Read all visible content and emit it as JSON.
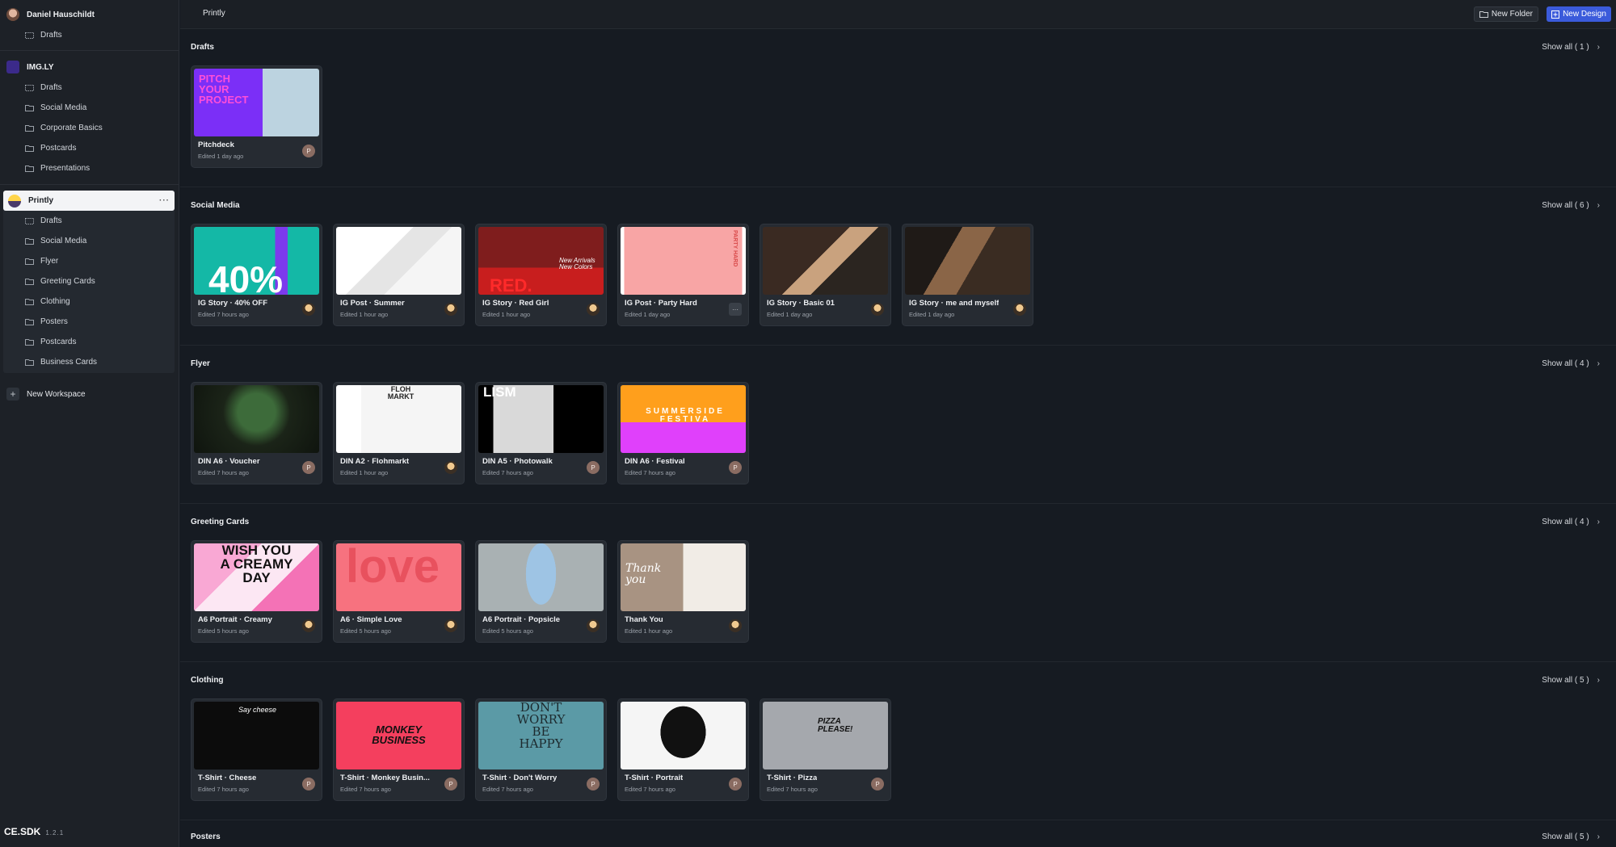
{
  "sidebar": {
    "user": {
      "name": "Daniel Hauschildt",
      "folders": [
        "Drafts"
      ]
    },
    "imgly": {
      "name": "IMG.LY",
      "folders": [
        "Drafts",
        "Social Media",
        "Corporate Basics",
        "Postcards",
        "Presentations"
      ]
    },
    "printly": {
      "name": "Printly",
      "folders": [
        "Drafts",
        "Social Media",
        "Flyer",
        "Greeting Cards",
        "Clothing",
        "Posters",
        "Postcards",
        "Business Cards"
      ]
    },
    "new_workspace": "New Workspace",
    "brand": "CE.SDK",
    "version": "1.2.1"
  },
  "topbar": {
    "title": "Printly",
    "new_folder": "New Folder",
    "new_design": "New Design"
  },
  "sections": [
    {
      "title": "Drafts",
      "show_all": "Show all ( 1 )",
      "cards": [
        {
          "name": "Pitchdeck",
          "edited": "Edited 1 day ago",
          "owner": "P"
        }
      ]
    },
    {
      "title": "Social Media",
      "show_all": "Show all ( 6 )",
      "cards": [
        {
          "name": "IG Story · 40% OFF",
          "edited": "Edited 7 hours ago"
        },
        {
          "name": "IG Post · Summer",
          "edited": "Edited 1 hour ago"
        },
        {
          "name": "IG Story · Red Girl",
          "edited": "Edited 1 hour ago"
        },
        {
          "name": "IG Post · Party Hard",
          "edited": "Edited 1 day ago",
          "owner": "···"
        },
        {
          "name": "IG Story · Basic 01",
          "edited": "Edited 1 day ago"
        },
        {
          "name": "IG Story · me and myself",
          "edited": "Edited 1 day ago"
        }
      ]
    },
    {
      "title": "Flyer",
      "show_all": "Show all ( 4 )",
      "cards": [
        {
          "name": "DIN A6 · Voucher",
          "edited": "Edited 7 hours ago",
          "owner": "P"
        },
        {
          "name": "DIN A2 · Flohmarkt",
          "edited": "Edited 1 hour ago"
        },
        {
          "name": "DIN A5 · Photowalk",
          "edited": "Edited 7 hours ago",
          "owner": "P"
        },
        {
          "name": "DIN A6 · Festival",
          "edited": "Edited 7 hours ago",
          "owner": "P"
        }
      ]
    },
    {
      "title": "Greeting Cards",
      "show_all": "Show all ( 4 )",
      "cards": [
        {
          "name": "A6 Portrait · Creamy",
          "edited": "Edited 5 hours ago"
        },
        {
          "name": "A6 · Simple Love",
          "edited": "Edited 5 hours ago"
        },
        {
          "name": "A6 Portrait · Popsicle",
          "edited": "Edited 5 hours ago"
        },
        {
          "name": "Thank You",
          "edited": "Edited 1 hour ago"
        }
      ]
    },
    {
      "title": "Clothing",
      "show_all": "Show all ( 5 )",
      "cards": [
        {
          "name": "T-Shirt · Cheese",
          "edited": "Edited 7 hours ago",
          "owner": "P"
        },
        {
          "name": "T-Shirt · Monkey Busin...",
          "edited": "Edited 7 hours ago",
          "owner": "P"
        },
        {
          "name": "T-Shirt · Don't Worry",
          "edited": "Edited 7 hours ago",
          "owner": "P"
        },
        {
          "name": "T-Shirt · Portrait",
          "edited": "Edited 7 hours ago",
          "owner": "P"
        },
        {
          "name": "T-Shirt · Pizza",
          "edited": "Edited 7 hours ago",
          "owner": "P"
        }
      ]
    },
    {
      "title": "Posters",
      "show_all": "Show all ( 5 )",
      "cards": []
    }
  ],
  "thumb_text": {
    "pitch": "PITCH YOUR PROJECT",
    "forty": "40%",
    "red": "RED.",
    "new_arrivals": "New Arrivals New Colors",
    "party": "PARTY HARD",
    "floh": "FLOH MARKT",
    "lism": "LISM",
    "summer": "SUMMERSIDE FESTIVA",
    "creamy": "WISH YOU A CREAMY DAY",
    "love": "love",
    "thank": "Thank you",
    "cheese": "Say cheese",
    "monkey": "MONKEY BUSINESS",
    "worry": "DON'T WORRY BE HAPPY",
    "pizza": "PIZZA PLEASE!"
  },
  "colors": {
    "accent": "#3b5bdb",
    "sidebar_bg": "#1d2127",
    "content_bg": "#161b22",
    "card_bg": "#262b32"
  }
}
